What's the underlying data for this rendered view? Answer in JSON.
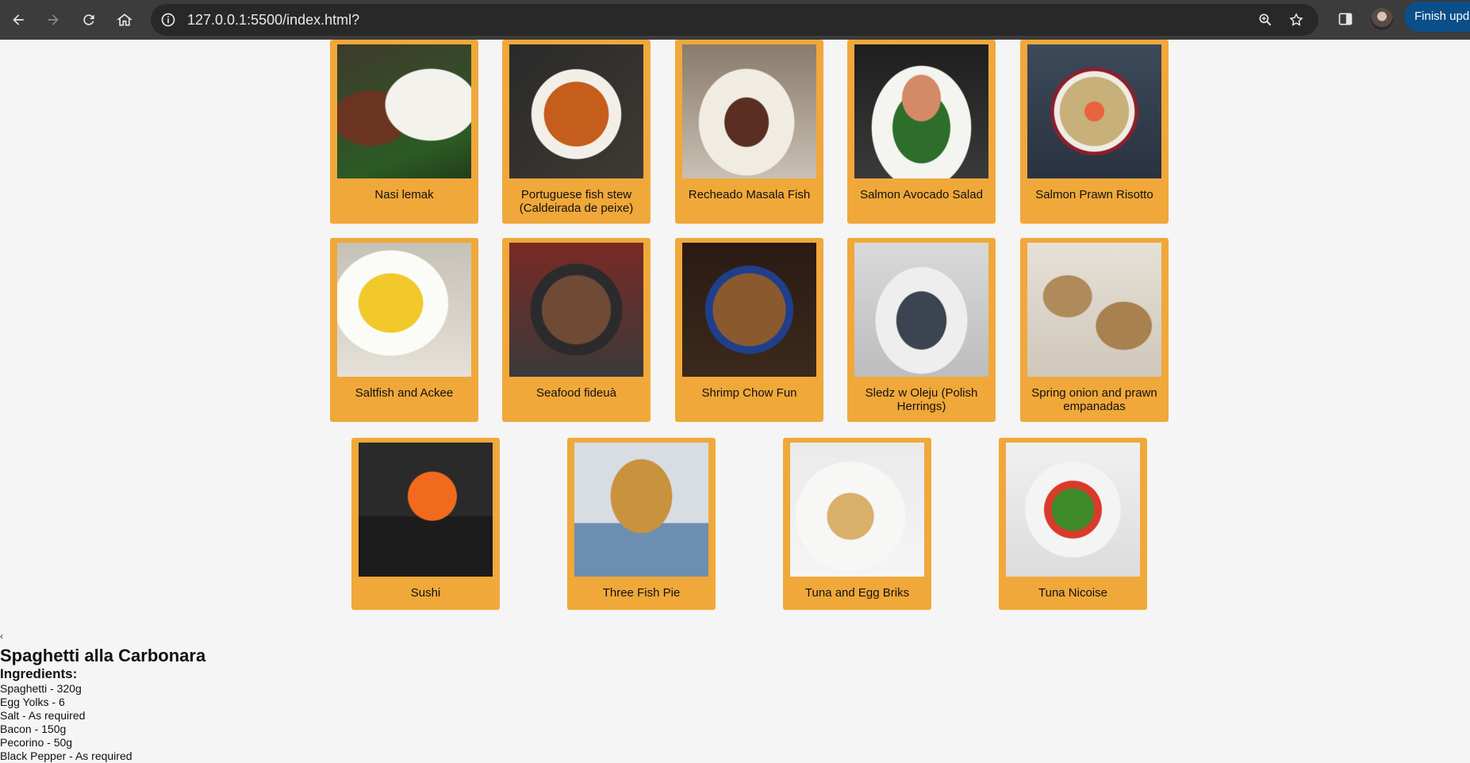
{
  "browser": {
    "url": "127.0.0.1:5500/index.html?",
    "update_label": "Finish update"
  },
  "recipes": [
    "Nasi lemak",
    "Portuguese fish stew (Caldeirada de peixe)",
    "Recheado Masala Fish",
    "Salmon Avocado Salad",
    "Salmon Prawn Risotto",
    "Saltfish and Ackee",
    "Seafood fideuà",
    "Shrimp Chow Fun",
    "Sledz w Oleju (Polish Herrings)",
    "Spring onion and prawn empanadas",
    "Sushi",
    "Three Fish Pie",
    "Tuna and Egg Briks",
    "Tuna Nicoise"
  ],
  "detail": {
    "back_label": "‹",
    "title": "Spaghetti alla Carbonara",
    "ingredients_heading": "Ingredients:",
    "ingredients": [
      "Spaghetti - 320g",
      "Egg Yolks - 6",
      "Salt - As required",
      "Bacon - 150g",
      "Pecorino - 50g",
      "Black Pepper - As required"
    ]
  },
  "colors": {
    "card": "#f0a83a",
    "page_bg": "#f5f5f5",
    "chrome": "#3c3c3c"
  }
}
